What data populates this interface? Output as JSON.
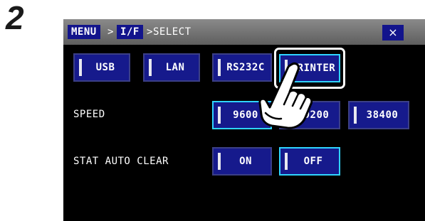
{
  "step_number": "2",
  "titlebar": {
    "crumb_menu": "MENU",
    "sep1": ">",
    "crumb_if": "I/F",
    "sep2": ">",
    "crumb_select": "SELECT",
    "close_label": "×"
  },
  "interface_buttons": [
    {
      "label": "USB",
      "selected": false
    },
    {
      "label": "LAN",
      "selected": false
    },
    {
      "label": "RS232C",
      "selected": false
    },
    {
      "label": "PRINTER",
      "selected": true
    }
  ],
  "speed": {
    "label": "SPEED",
    "options": [
      {
        "label": "9600",
        "selected": true
      },
      {
        "label": "19200",
        "selected": false
      },
      {
        "label": "38400",
        "selected": false
      }
    ]
  },
  "stat_auto_clear": {
    "label": "STAT AUTO CLEAR",
    "options": [
      {
        "label": "ON",
        "selected": false
      },
      {
        "label": "OFF",
        "selected": true
      }
    ]
  },
  "colors": {
    "button_bg": "#161a8c",
    "selected_border": "#2fd4ff",
    "screen_bg": "#000000",
    "titlebar": "#6e6e6e"
  },
  "icons": {
    "close": "close-icon",
    "pointer": "pointing-hand-icon"
  }
}
